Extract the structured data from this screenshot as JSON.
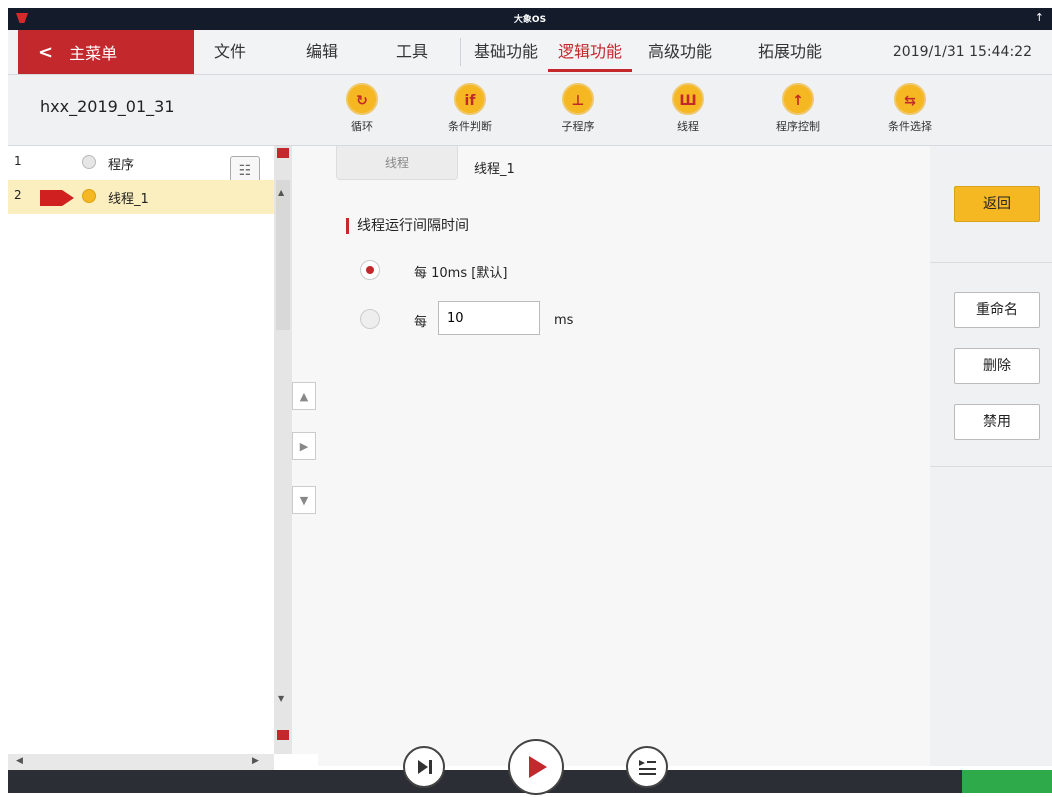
{
  "system": {
    "title": "大象OS",
    "up_arrow": "↑"
  },
  "menubar": {
    "main_menu": "主菜单",
    "items": [
      "文件",
      "编辑",
      "工具",
      "基础功能",
      "逻辑功能",
      "高级功能",
      "拓展功能"
    ],
    "active": "逻辑功能",
    "datetime": "2019/1/31 15:44:22"
  },
  "toolbar": {
    "filename": "hxx_2019_01_31",
    "tools": [
      {
        "label": "循环",
        "icon": "loop-icon",
        "glyph": "↻"
      },
      {
        "label": "条件判断",
        "icon": "if-icon",
        "glyph": "if"
      },
      {
        "label": "子程序",
        "icon": "subprogram-icon",
        "glyph": "⊥"
      },
      {
        "label": "线程",
        "icon": "thread-icon",
        "glyph": "Ш"
      },
      {
        "label": "程序控制",
        "icon": "program-control-icon",
        "glyph": "↑"
      },
      {
        "label": "条件选择",
        "icon": "condition-select-icon",
        "glyph": "⇆"
      }
    ]
  },
  "tree": {
    "rows": [
      {
        "num": "1",
        "label": "程序"
      },
      {
        "num": "2",
        "label": "线程_1"
      }
    ]
  },
  "content": {
    "tab": "线程",
    "thread_name": "线程_1",
    "section_title": "线程运行间隔时间",
    "option1": "每 10ms [默认]",
    "option2_prefix": "每",
    "option2_value": "10",
    "option2_unit": "ms"
  },
  "rpanel": {
    "back": "返回",
    "rename": "重命名",
    "delete": "删除",
    "disable": "禁用"
  },
  "colors": {
    "accent": "#c2282c",
    "yellow": "#f5b722",
    "green": "#2faa4a"
  }
}
